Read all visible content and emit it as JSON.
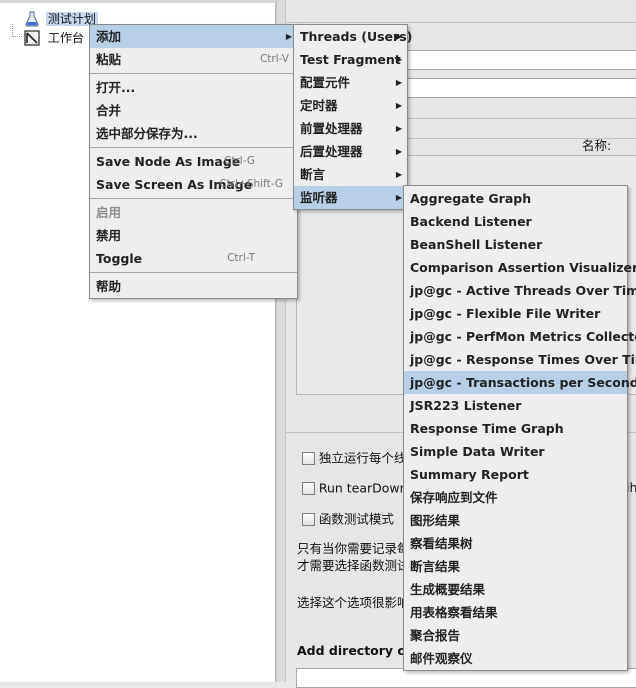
{
  "tree": {
    "items": [
      {
        "label": "测试计划",
        "icon": "test-plan-icon"
      },
      {
        "label": "工作台",
        "icon": "workbench-icon"
      }
    ]
  },
  "right_panel": {
    "name_label": "名称:",
    "checkbox_serial": "独立运行每个线",
    "checkbox_teardown": "Run tearDown T",
    "checkbox_teardown_tail": "ihr",
    "checkbox_functional": "函数测试模式",
    "note_line1": "只有当你需要记录每",
    "note_line2": "才需要选择函数测试",
    "note_line3": "选择这个选项很影响",
    "classpath_label": "Add directory or jar"
  },
  "context_menu": {
    "items": [
      {
        "label": "添加",
        "submenu": true,
        "highlighted": true
      },
      {
        "label": "粘贴",
        "shortcut": "Ctrl-V"
      },
      {
        "separator": true
      },
      {
        "label": "打开..."
      },
      {
        "label": "合并"
      },
      {
        "label": "选中部分保存为..."
      },
      {
        "separator": true
      },
      {
        "label": "Save Node As Image",
        "shortcut": "Ctrl-G"
      },
      {
        "label": "Save Screen As Image",
        "shortcut": "Ctrl+Shift-G"
      },
      {
        "separator": true
      },
      {
        "label": "启用",
        "disabled": true
      },
      {
        "label": "禁用"
      },
      {
        "label": "Toggle",
        "shortcut": "Ctrl-T"
      },
      {
        "separator": true
      },
      {
        "label": "帮助"
      }
    ]
  },
  "add_submenu": {
    "items": [
      {
        "label": "Threads (Users)",
        "submenu": true
      },
      {
        "label": "Test Fragment",
        "submenu": true
      },
      {
        "label": "配置元件",
        "submenu": true
      },
      {
        "label": "定时器",
        "submenu": true
      },
      {
        "label": "前置处理器",
        "submenu": true
      },
      {
        "label": "后置处理器",
        "submenu": true
      },
      {
        "label": "断言",
        "submenu": true
      },
      {
        "label": "监听器",
        "submenu": true,
        "highlighted": true
      }
    ]
  },
  "listener_submenu": {
    "items": [
      {
        "label": "Aggregate Graph"
      },
      {
        "label": "Backend Listener"
      },
      {
        "label": "BeanShell Listener"
      },
      {
        "label": "Comparison Assertion Visualizer"
      },
      {
        "label": "jp@gc - Active Threads Over Time"
      },
      {
        "label": "jp@gc - Flexible File Writer"
      },
      {
        "label": "jp@gc - PerfMon Metrics Collector"
      },
      {
        "label": "jp@gc - Response Times Over Time"
      },
      {
        "label": "jp@gc - Transactions per Second",
        "highlighted": true
      },
      {
        "label": "JSR223 Listener"
      },
      {
        "label": "Response Time Graph"
      },
      {
        "label": "Simple Data Writer"
      },
      {
        "label": "Summary Report"
      },
      {
        "label": "保存响应到文件"
      },
      {
        "label": "图形结果"
      },
      {
        "label": "察看结果树"
      },
      {
        "label": "断言结果"
      },
      {
        "label": "生成概要结果"
      },
      {
        "label": "用表格察看结果"
      },
      {
        "label": "聚合报告"
      },
      {
        "label": "邮件观察仪"
      }
    ]
  },
  "colors": {
    "menu_bg": "#eeeeee",
    "highlight": "#b8cfe5",
    "selected_tree": "#c8d8ee",
    "disabled_text": "#8d8d8d"
  }
}
